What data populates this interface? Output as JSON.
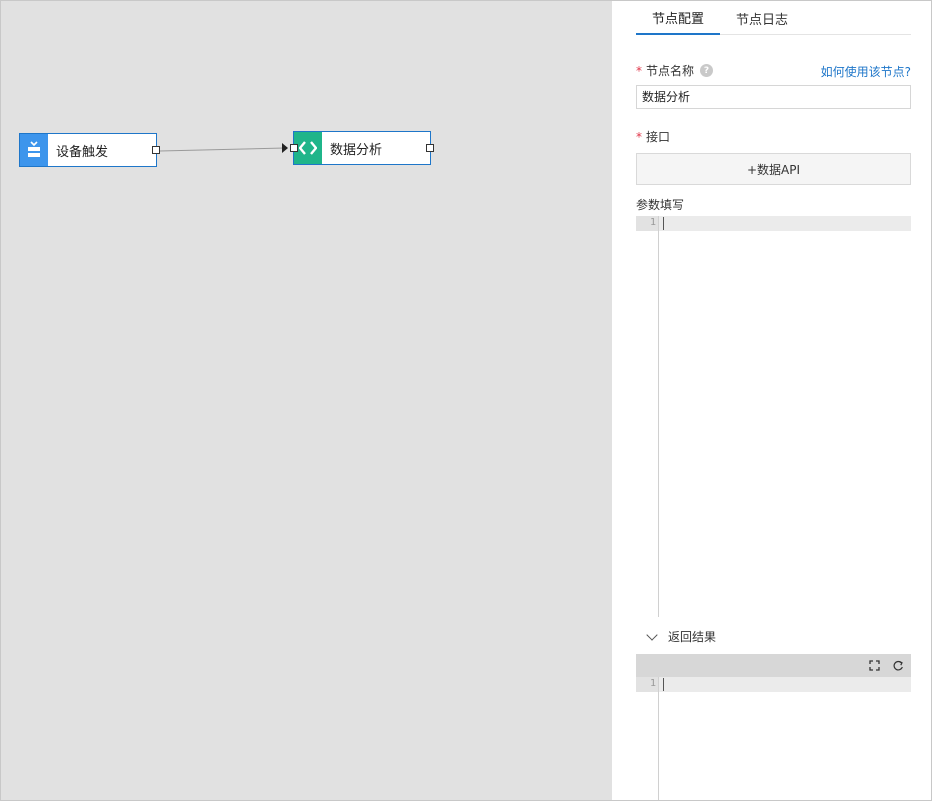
{
  "canvas": {
    "nodes": [
      {
        "label": "设备触发",
        "icon": "device-trigger-icon",
        "color": "#3d95ec"
      },
      {
        "label": "数据分析",
        "icon": "code-icon",
        "color": "#1fb58a"
      }
    ]
  },
  "panel": {
    "tabs": [
      {
        "label": "节点配置",
        "active": true
      },
      {
        "label": "节点日志",
        "active": false
      }
    ],
    "node_name": {
      "required_mark": "*",
      "label": "节点名称",
      "help_icon": "question-icon",
      "help_link": "如何使用该节点?",
      "value": "数据分析"
    },
    "interface": {
      "required_mark": "*",
      "label": "接口",
      "button_label": "+数据API"
    },
    "params": {
      "label": "参数填写",
      "line_number": "1"
    },
    "result": {
      "label": "返回结果",
      "line_number": "1",
      "toolbar_icons": [
        "fullscreen-icon",
        "refresh-icon"
      ]
    }
  },
  "colors": {
    "accent": "#1e76c9",
    "required": "#e0364a",
    "canvas_bg": "#e1e1e1"
  }
}
